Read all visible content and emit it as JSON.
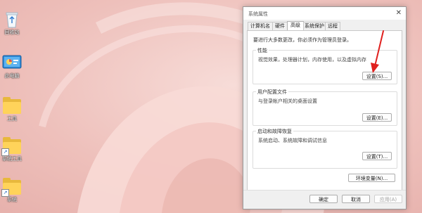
{
  "desktop": {
    "icons": [
      {
        "label": "回收站",
        "kind": "recycle-bin"
      },
      {
        "label": "此电脑",
        "kind": "control-panel"
      },
      {
        "label": "工具",
        "kind": "folder"
      },
      {
        "label": "系统工具",
        "kind": "folder-shortcut"
      },
      {
        "label": "系统",
        "kind": "folder-shortcut"
      }
    ]
  },
  "dialog": {
    "title": "系统属性",
    "close_glyph": "✕",
    "tabs": [
      "计算机名",
      "硬件",
      "高级",
      "系统保护",
      "远程"
    ],
    "active_tab": "高级",
    "admin_note": "要进行大多数更改，你必须作为管理员登录。",
    "performance": {
      "title": "性能",
      "description": "视觉效果，处理器计划，内存使用，以及虚拟内存",
      "button": "设置(S)..."
    },
    "user_profiles": {
      "title": "用户配置文件",
      "description": "与登录帐户相关的桌面设置",
      "button": "设置(E)..."
    },
    "startup_recovery": {
      "title": "启动和故障恢复",
      "description": "系统启动、系统故障和调试信息",
      "button": "设置(T)..."
    },
    "env_button": "环境变量(N)...",
    "ok_button": "确定",
    "cancel_button": "取消",
    "apply_button": "应用(A)"
  },
  "colors": {
    "wallpaper": "#f3ccc8",
    "arrow": "#e0201e",
    "folder": "#ffd35a"
  }
}
